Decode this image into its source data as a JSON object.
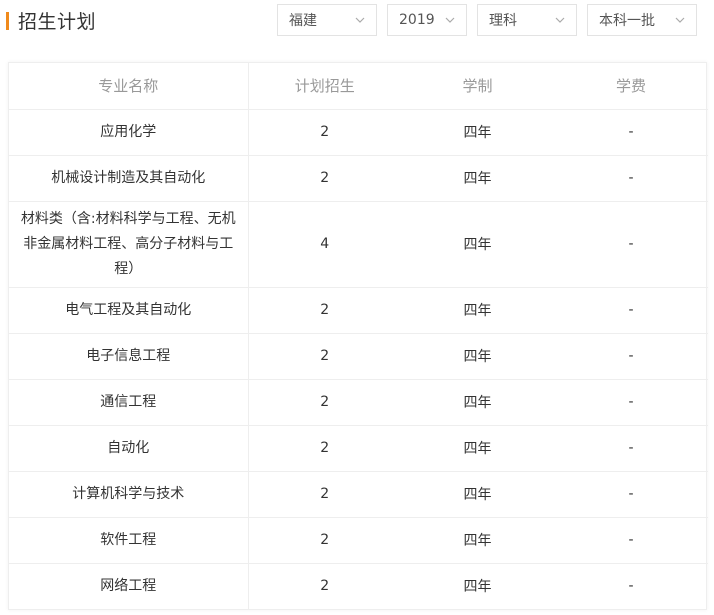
{
  "header": {
    "title": "招生计划"
  },
  "filters": {
    "province": "福建",
    "year": "2019",
    "subject": "理科",
    "batch": "本科一批"
  },
  "table": {
    "columns": [
      "专业名称",
      "计划招生",
      "学制",
      "学费"
    ],
    "rows": [
      {
        "major": "应用化学",
        "plan": "2",
        "duration": "四年",
        "fee": "-"
      },
      {
        "major": "机械设计制造及其自动化",
        "plan": "2",
        "duration": "四年",
        "fee": "-"
      },
      {
        "major": "材料类（含:材料科学与工程、无机非金属材料工程、高分子材料与工程）",
        "plan": "4",
        "duration": "四年",
        "fee": "-"
      },
      {
        "major": "电气工程及其自动化",
        "plan": "2",
        "duration": "四年",
        "fee": "-"
      },
      {
        "major": "电子信息工程",
        "plan": "2",
        "duration": "四年",
        "fee": "-"
      },
      {
        "major": "通信工程",
        "plan": "2",
        "duration": "四年",
        "fee": "-"
      },
      {
        "major": "自动化",
        "plan": "2",
        "duration": "四年",
        "fee": "-"
      },
      {
        "major": "计算机科学与技术",
        "plan": "2",
        "duration": "四年",
        "fee": "-"
      },
      {
        "major": "软件工程",
        "plan": "2",
        "duration": "四年",
        "fee": "-"
      },
      {
        "major": "网络工程",
        "plan": "2",
        "duration": "四年",
        "fee": "-"
      }
    ]
  },
  "colors": {
    "accent": "#f08a1c",
    "header_text": "#999999",
    "border": "#eeeeee"
  },
  "icons": {
    "select_arrow": "chevron-down-icon"
  }
}
